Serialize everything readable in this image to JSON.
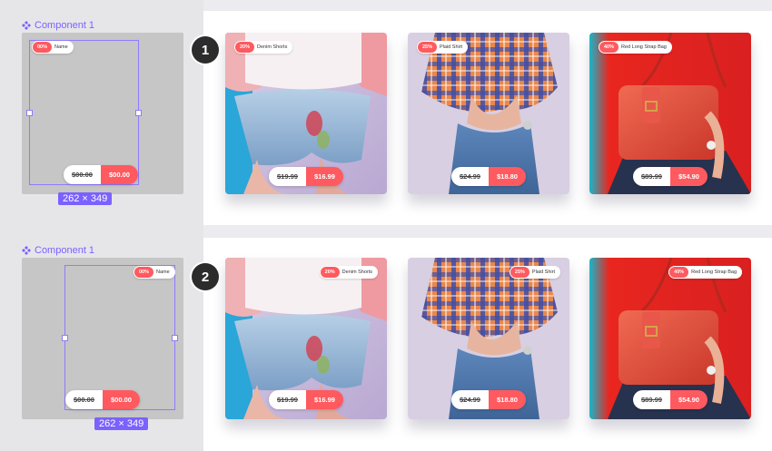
{
  "colors": {
    "accent": "#7b61ff",
    "sale": "#ff5a5f",
    "frame_gray": "#c6c6c6"
  },
  "icons": {
    "component": "component-icon"
  },
  "sections": [
    {
      "step": "1",
      "component_label": "Component 1",
      "dimensions": "262 × 349",
      "placeholder": {
        "discount": "00%",
        "name": "Name",
        "old_price": "$00.00",
        "new_price": "$00.00"
      }
    },
    {
      "step": "2",
      "component_label": "Component 1",
      "dimensions": "262 × 349",
      "placeholder": {
        "discount": "00%",
        "name": "Name",
        "old_price": "$00.00",
        "new_price": "$00.00"
      }
    }
  ],
  "products": [
    {
      "discount": "20%",
      "name": "Denim Shorts",
      "old_price": "$19.99",
      "new_price": "$16.99"
    },
    {
      "discount": "25%",
      "name": "Plaid Shirt",
      "old_price": "$24.99",
      "new_price": "$18.80"
    },
    {
      "discount": "40%",
      "name": "Red Long Strap Bag",
      "old_price": "$89.99",
      "new_price": "$54.90"
    }
  ]
}
